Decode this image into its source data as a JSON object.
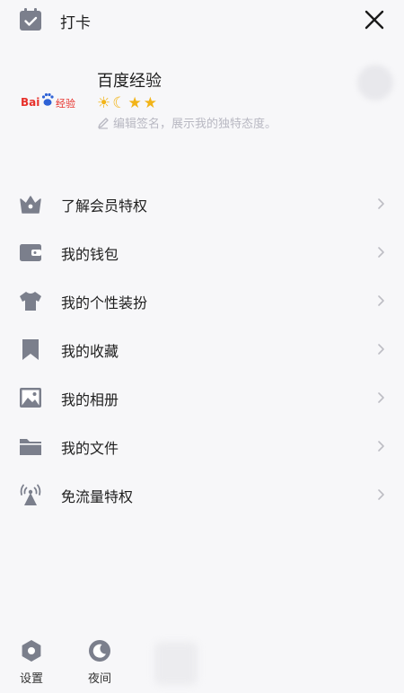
{
  "header": {
    "checkin_label": "打卡"
  },
  "profile": {
    "avatar_brand": "Bai",
    "avatar_suffix": "经验",
    "username": "百度经验",
    "badges": [
      "☀",
      "☾",
      "★",
      "★"
    ],
    "signature": "编辑签名，展示我的独特态度。"
  },
  "menu": {
    "items": [
      {
        "label": "了解会员特权",
        "icon": "crown-icon"
      },
      {
        "label": "我的钱包",
        "icon": "wallet-icon"
      },
      {
        "label": "我的个性装扮",
        "icon": "tshirt-icon"
      },
      {
        "label": "我的收藏",
        "icon": "bookmark-icon"
      },
      {
        "label": "我的相册",
        "icon": "image-icon"
      },
      {
        "label": "我的文件",
        "icon": "folder-icon"
      },
      {
        "label": "免流量特权",
        "icon": "signal-tower-icon"
      }
    ]
  },
  "bottom": {
    "settings_label": "设置",
    "night_label": "夜间"
  },
  "colors": {
    "icon_gray": "#7b7f8c",
    "signature_gray": "#b8b8c2",
    "badge_gold": "#f2b418",
    "brand_red": "#e7302a",
    "brand_blue": "#2e62d6"
  }
}
